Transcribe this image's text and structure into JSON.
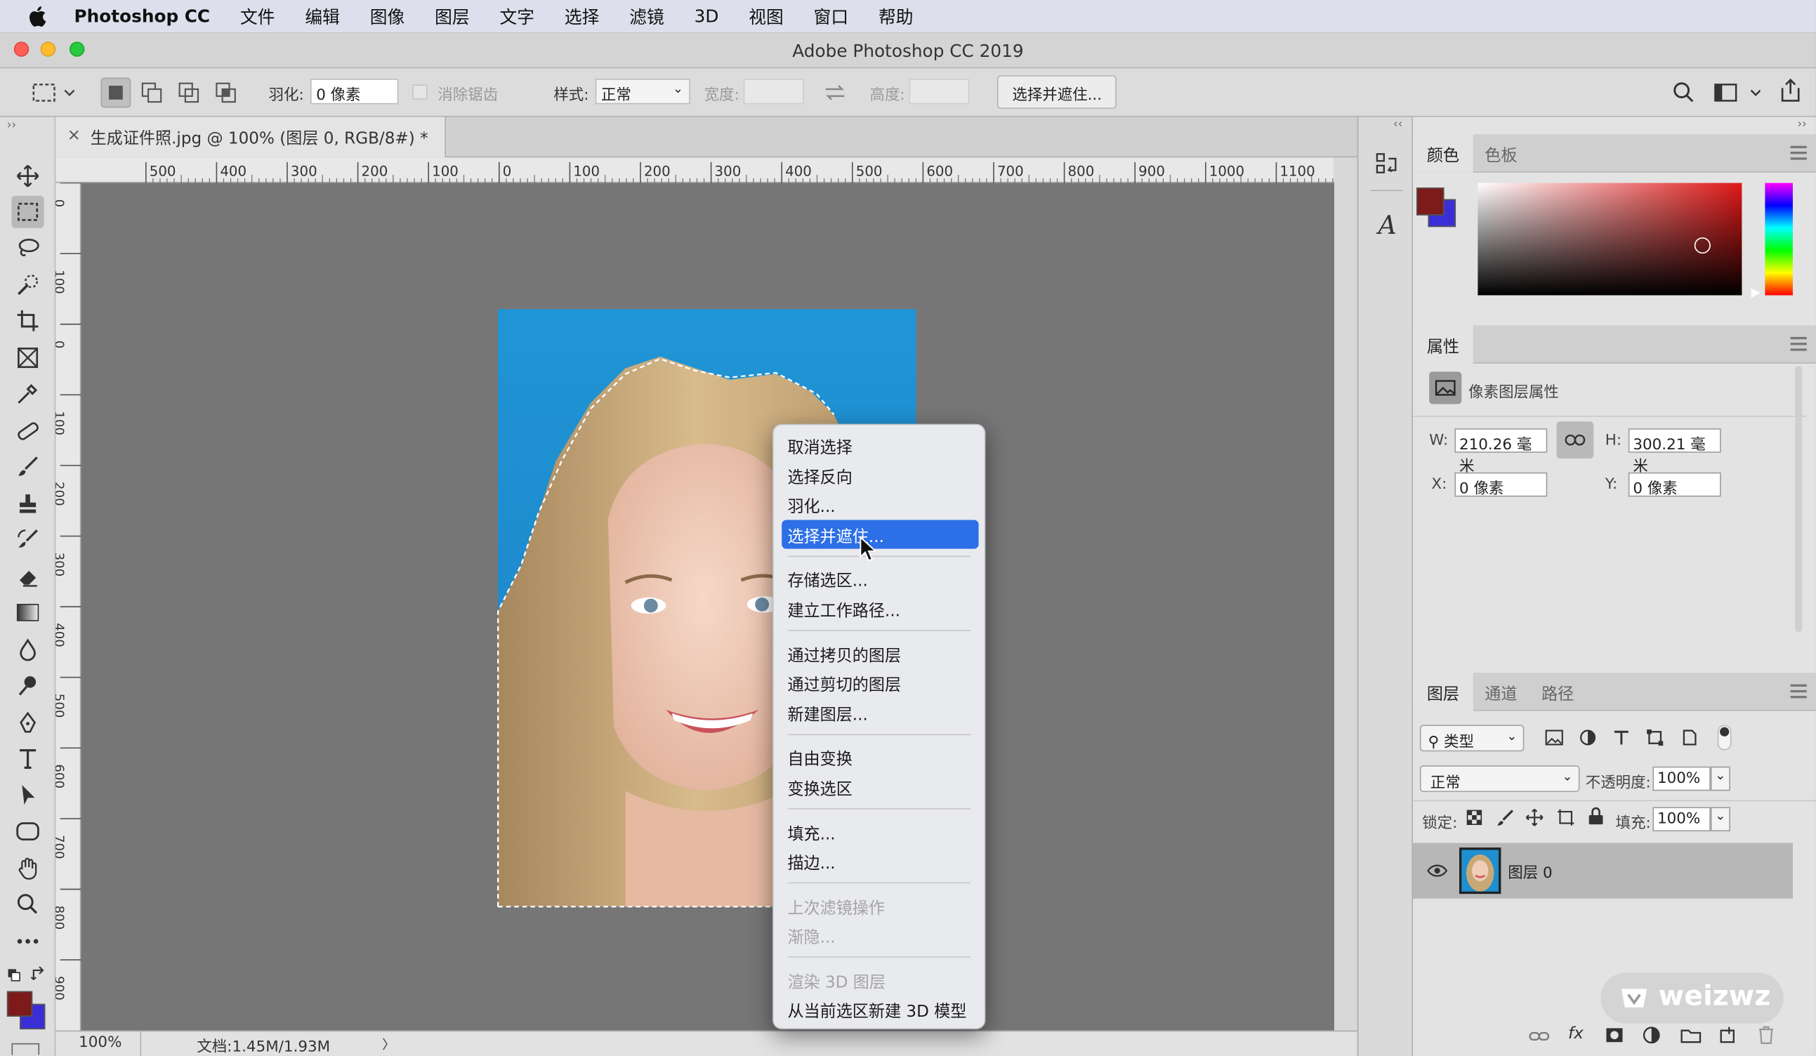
{
  "menubar": {
    "app_name": "Photoshop CC",
    "items": [
      "文件",
      "编辑",
      "图像",
      "图层",
      "文字",
      "选择",
      "滤镜",
      "3D",
      "视图",
      "窗口",
      "帮助"
    ]
  },
  "window": {
    "title": "Adobe Photoshop CC 2019"
  },
  "options": {
    "feather_label": "羽化:",
    "feather_value": "0 像素",
    "antialias_label": "消除锯齿",
    "style_label": "样式:",
    "style_value": "正常",
    "width_label": "宽度:",
    "height_label": "高度:",
    "select_mask_button": "选择并遮住..."
  },
  "document": {
    "tab_title": "生成证件照.jpg @ 100% (图层 0, RGB/8#) *",
    "close_glyph": "×"
  },
  "ruler": {
    "h_labels": [
      "500",
      "400",
      "300",
      "200",
      "100",
      "0",
      "100",
      "200",
      "300",
      "400",
      "500",
      "600",
      "700",
      "800",
      "900",
      "1000",
      "1100"
    ],
    "v_labels": [
      "0",
      "100",
      "0",
      "100",
      "200",
      "300",
      "400",
      "500",
      "600",
      "700",
      "800",
      "900"
    ]
  },
  "status": {
    "zoom": "100%",
    "doc_info": "文档:1.45M/1.93M",
    "arrow": "〉"
  },
  "context_menu": {
    "items": [
      {
        "label": "取消选择",
        "state": "normal"
      },
      {
        "label": "选择反向",
        "state": "normal"
      },
      {
        "label": "羽化...",
        "state": "normal"
      },
      {
        "label": "选择并遮住...",
        "state": "highlighted"
      },
      {
        "label": "存储选区...",
        "state": "normal"
      },
      {
        "label": "建立工作路径...",
        "state": "normal"
      },
      {
        "label": "通过拷贝的图层",
        "state": "normal"
      },
      {
        "label": "通过剪切的图层",
        "state": "normal"
      },
      {
        "label": "新建图层...",
        "state": "normal"
      },
      {
        "label": "自由变换",
        "state": "normal"
      },
      {
        "label": "变换选区",
        "state": "normal"
      },
      {
        "label": "填充...",
        "state": "normal"
      },
      {
        "label": "描边...",
        "state": "normal"
      },
      {
        "label": "上次滤镜操作",
        "state": "disabled"
      },
      {
        "label": "渐隐...",
        "state": "disabled"
      },
      {
        "label": "渲染 3D 图层",
        "state": "disabled"
      },
      {
        "label": "从当前选区新建 3D 模型",
        "state": "normal"
      }
    ]
  },
  "color_panel": {
    "tabs": [
      "颜色",
      "色板"
    ],
    "foreground": "#7d1a1a",
    "background": "#3a2fd6",
    "hue_color": "#e01818"
  },
  "properties_panel": {
    "tab": "属性",
    "heading": "像素图层属性",
    "w_label": "W:",
    "w_value": "210.26 毫米",
    "h_label": "H:",
    "h_value": "300.21 毫米",
    "x_label": "X:",
    "x_value": "0 像素",
    "y_label": "Y:",
    "y_value": "0 像素"
  },
  "layers_panel": {
    "tabs": [
      "图层",
      "通道",
      "路径"
    ],
    "filter_label": "类型",
    "blend_mode": "正常",
    "opacity_label": "不透明度:",
    "opacity_value": "100%",
    "lock_label": "锁定:",
    "fill_label": "填充:",
    "fill_value": "100%",
    "layers": [
      {
        "name": "图层 0",
        "visible": true,
        "selected": true
      }
    ]
  },
  "watermark": {
    "text": "weizwz"
  },
  "colors": {
    "menubar_bg": "#dde0ec",
    "panel_bg": "#e3e3e3",
    "canvas_bg": "#767676",
    "photo_blue": "#1e8fd0",
    "highlight": "#2c6fe6"
  }
}
